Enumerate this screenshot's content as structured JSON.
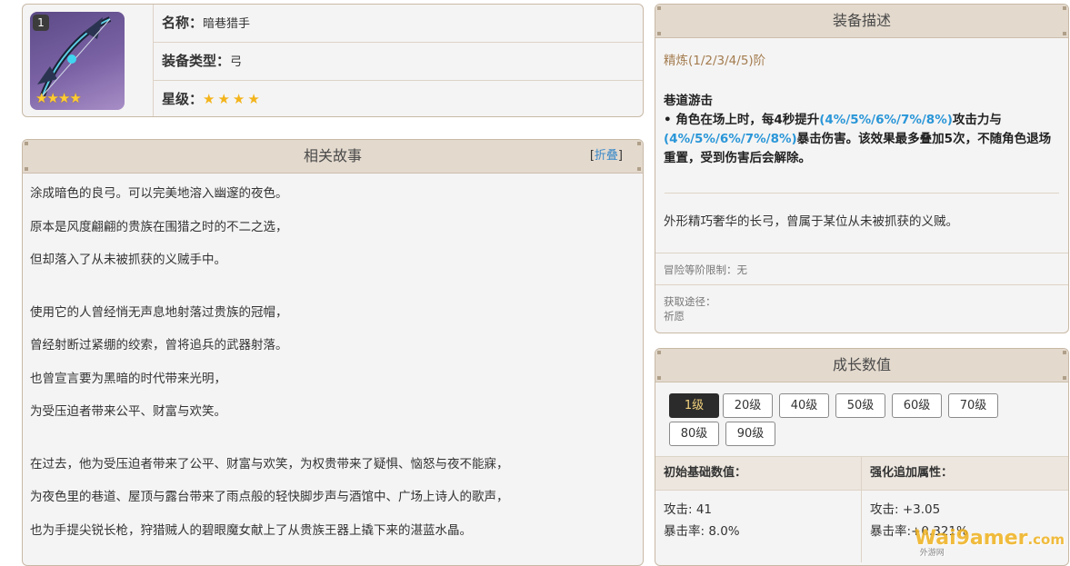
{
  "item": {
    "badge": "1",
    "image_stars": "★★★★",
    "name_label": "名称：",
    "name_value": "暗巷猎手",
    "type_label": "装备类型：",
    "type_value": "弓",
    "rarity_label": "星级：",
    "rarity_stars": "★★★★",
    "rarity": 4
  },
  "story": {
    "title": "相关故事",
    "fold_open": "[",
    "fold_link": "折叠",
    "fold_close": "]",
    "para1": [
      "涂成暗色的良弓。可以完美地溶入幽邃的夜色。",
      "原本是风度翩翩的贵族在围猎之时的不二之选，",
      "但却落入了从未被抓获的义贼手中。"
    ],
    "para2": [
      "使用它的人曾经悄无声息地射落过贵族的冠帽，",
      "曾经射断过紧绷的绞索，曾将追兵的武器射落。",
      "也曾宣言要为黑暗的时代带来光明，",
      "为受压迫者带来公平、财富与欢笑。"
    ],
    "para3": [
      "在过去，他为受压迫者带来了公平、财富与欢笑，为权贵带来了疑惧、恼怒与夜不能寐，",
      "为夜色里的巷道、屋顶与露台带来了雨点般的轻快脚步声与酒馆中、广场上诗人的歌声，",
      "也为手提尖锐长枪，狩猎贼人的碧眼魔女献上了从贵族王器上撬下来的湛蓝水晶。"
    ]
  },
  "equip": {
    "title": "装备描述",
    "refine": "精炼(1/2/3/4/5)阶",
    "passive_name": "巷道游击",
    "passive_a": "• 角色在场上时，每4秒提升",
    "passive_hl1": "(4%/5%/6%/7%/8%)",
    "passive_b": "攻击力与",
    "passive_hl2": "(4%/5%/6%/7%/8%)",
    "passive_c": "暴击伤害。该效果最多叠加5次，不随角色退场重置，受到伤害后会解除。",
    "description": "外形精巧奢华的长弓，曾属于某位从未被抓获的义贼。",
    "ascension_limit": "冒险等阶限制：无",
    "source_label": "获取途径：",
    "source_value": "祈愿"
  },
  "growth": {
    "title": "成长数值",
    "levels": [
      "1级",
      "20级",
      "40级",
      "50级",
      "60级",
      "70级",
      "80级",
      "90级"
    ],
    "selected_level": "1级",
    "base_header": "初始基础数值：",
    "bonus_header": "强化追加属性：",
    "base_atk": "攻击: 41",
    "base_crit": "暴击率: 8.0%",
    "bonus_atk": "攻击: +3.05",
    "bonus_crit": "暴击率:+0.321%"
  },
  "watermark": {
    "text": "Wai9amer",
    "suffix": ".com",
    "sub": "外游网"
  },
  "colors": {
    "header_bg": "#e3d9cd",
    "accent_blue": "#2996d8",
    "refine_brown": "#a37c4f",
    "star_gold": "#f3b41b"
  }
}
